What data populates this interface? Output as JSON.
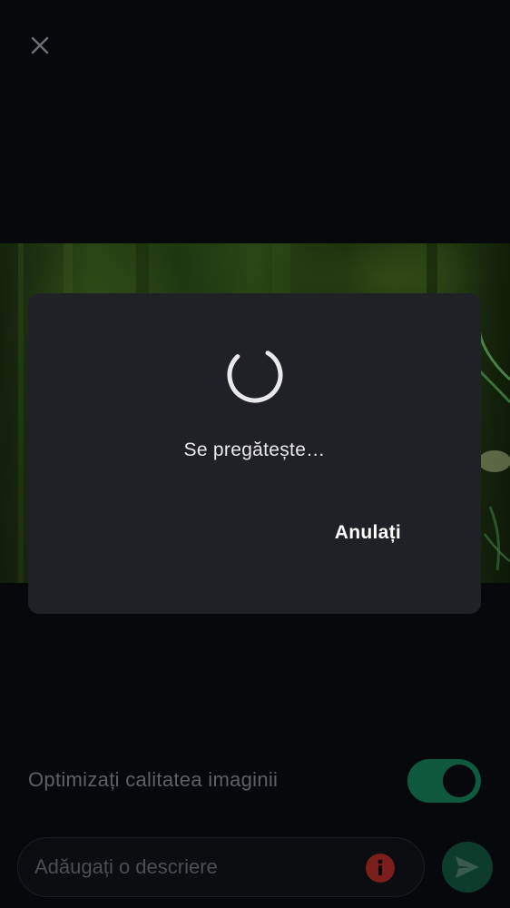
{
  "header": {
    "close_icon": "close-icon"
  },
  "media": {
    "description": "photo-preview"
  },
  "dialog": {
    "message": "Se pregătește…",
    "cancel_label": "Anulați",
    "spinner_icon": "progress-spinner-icon"
  },
  "options": {
    "optimize_label": "Optimizați calitatea imaginii",
    "optimize_enabled": true
  },
  "composer": {
    "placeholder": "Adăugați o descriere",
    "info_icon": "info-icon",
    "send_icon": "send-icon"
  },
  "colors": {
    "background": "#07080b",
    "dialog": "#202126",
    "toggle_on": "#0f5a3e",
    "send_button": "#0d3b2c",
    "info_badge": "#7c1e1c"
  }
}
